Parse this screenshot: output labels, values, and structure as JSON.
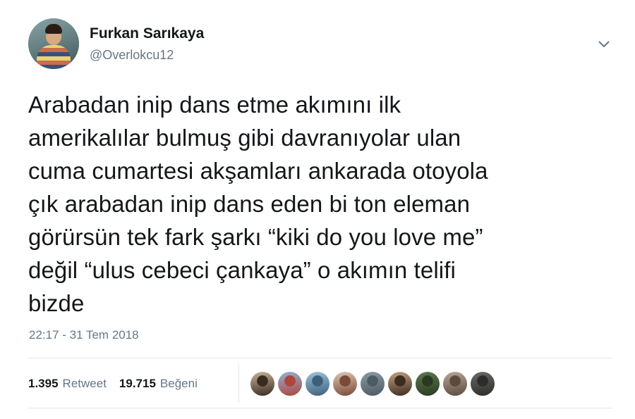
{
  "user": {
    "name": "Furkan Sarıkaya",
    "handle": "@Overlokcu12"
  },
  "tweet": {
    "text": "Arabadan inip dans etme akımını ilk\namerikalılar bulmuş gibi davranıyolar ulan\ncuma cumartesi akşamları ankarada otoyola\nçık arabadan inip dans eden bi ton eleman\ngörürsün tek fark şarkı “kiki do you love me”\ndeğil “ulus cebeci çankaya” o akımın telifi\nbizde",
    "timestamp": "22:17 - 31 Tem 2018"
  },
  "stats": {
    "retweet_count": "1.395",
    "retweet_label": "Retweet",
    "like_count": "19.715",
    "like_label": "Beğeni"
  },
  "icons": {
    "menu": "chevron-down-icon"
  },
  "colors": {
    "text": "#14171a",
    "secondary": "#657786",
    "divider": "#e1e8ed"
  },
  "likers": [
    {
      "name": "liker-avatar-1",
      "colors": [
        "#c9b49a",
        "#3a2a20"
      ]
    },
    {
      "name": "liker-avatar-2",
      "colors": [
        "#8fb3d6",
        "#b0453a"
      ]
    },
    {
      "name": "liker-avatar-3",
      "colors": [
        "#9cc3de",
        "#3d5f7a"
      ]
    },
    {
      "name": "liker-avatar-4",
      "colors": [
        "#e0c6b4",
        "#7a4a3a"
      ]
    },
    {
      "name": "liker-avatar-5",
      "colors": [
        "#8e9aa3",
        "#4c5a63"
      ]
    },
    {
      "name": "liker-avatar-6",
      "colors": [
        "#c4a27c",
        "#3b2b22"
      ]
    },
    {
      "name": "liker-avatar-7",
      "colors": [
        "#5d7a4f",
        "#2a3a22"
      ]
    },
    {
      "name": "liker-avatar-8",
      "colors": [
        "#b9a796",
        "#5b4a3e"
      ]
    },
    {
      "name": "liker-avatar-9",
      "colors": [
        "#6c6a66",
        "#2e2c2a"
      ]
    }
  ]
}
